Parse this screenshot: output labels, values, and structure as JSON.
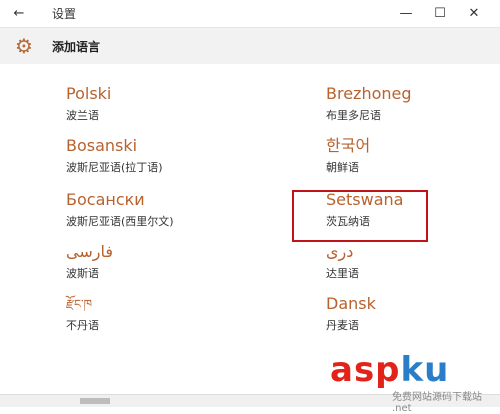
{
  "window": {
    "title": "设置",
    "back_icon": "back-arrow-icon",
    "buttons": {
      "minimize": "—",
      "maximize": "☐",
      "close": "✕"
    }
  },
  "header": {
    "icon": "gear-icon",
    "title": "添加语言"
  },
  "languages": [
    {
      "native": "Polski",
      "cn": "波兰语"
    },
    {
      "native": "Brezhoneg",
      "cn": "布里多尼语"
    },
    {
      "native": "Bosanski",
      "cn": "波斯尼亚语(拉丁语)"
    },
    {
      "native": "한국어",
      "cn": "朝鲜语"
    },
    {
      "native": "Босански",
      "cn": "波斯尼亚语(西里尔文)"
    },
    {
      "native": "Setswana",
      "cn": "茨瓦纳语"
    },
    {
      "native": "فارسى",
      "cn": "波斯语"
    },
    {
      "native": "درى",
      "cn": "达里语"
    },
    {
      "native": "རྫོང་ཁ",
      "cn": "不丹语"
    },
    {
      "native": "Dansk",
      "cn": "丹麦语"
    }
  ],
  "watermark": {
    "asp": "asp",
    "ku": "ku",
    "sub": "免费网站源码下载站",
    "dot": ".net"
  },
  "colors": {
    "accent": "#b8622f",
    "highlight": "#c0141c"
  }
}
